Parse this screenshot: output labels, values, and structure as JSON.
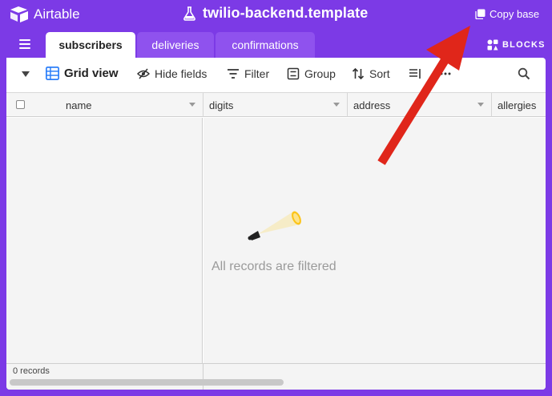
{
  "app": {
    "name": "Airtable",
    "base_title": "twilio-backend.template",
    "copy_base_label": "Copy base",
    "blocks_label": "BLOCKS"
  },
  "tabs": [
    {
      "label": "subscribers",
      "active": true
    },
    {
      "label": "deliveries",
      "active": false
    },
    {
      "label": "confirmations",
      "active": false
    }
  ],
  "toolbar": {
    "view_name": "Grid view",
    "hide_fields": "Hide fields",
    "filter": "Filter",
    "group": "Group",
    "sort": "Sort"
  },
  "columns": {
    "primary": "name",
    "c1": "digits",
    "c2": "address",
    "c3": "allergies"
  },
  "empty_state": {
    "message": "All records are filtered"
  },
  "footer": {
    "records": "0 records"
  },
  "colors": {
    "brand": "#7c3ae6",
    "annotation": "#e0261a"
  },
  "icons": {
    "logo": "airtable-logo-icon",
    "title": "flask-icon",
    "copy": "copy-icon",
    "blocks": "blocks-icon",
    "menu": "hamburger-icon",
    "grid": "grid-icon",
    "hide": "eye-slash-icon",
    "filter": "filter-icon",
    "group": "group-icon",
    "sort": "sort-icon",
    "row_height": "row-height-icon",
    "more": "more-icon",
    "search": "search-icon"
  }
}
